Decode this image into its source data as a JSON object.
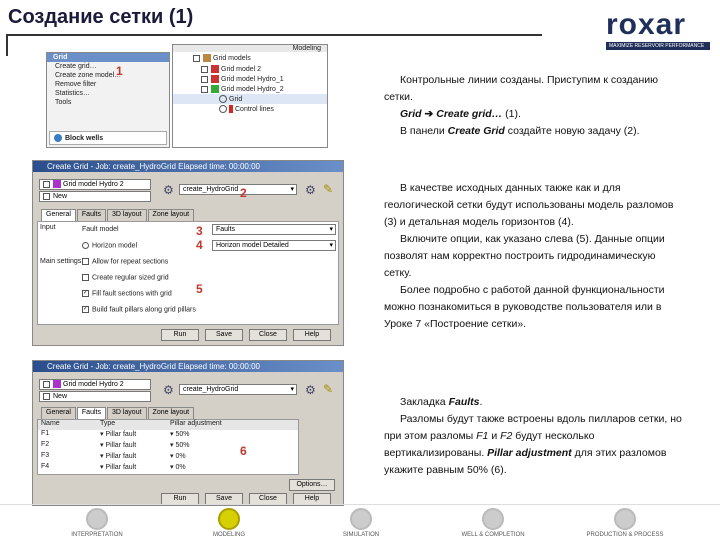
{
  "slide": {
    "title": "Создание сетки (1)",
    "logo_text": "roxar",
    "logo_sub": "MAXIMIZE RESERVOIR PERFORMANCE"
  },
  "text_blocks": {
    "p1a": "Контрольные линии созданы. Приступим к созданию сетки.",
    "p1b_menu": "Grid",
    "p1b_arrow": "➔",
    "p1b_item": "Create grid…",
    "p1b_num": "(1).",
    "p1c_pre": "В панели ",
    "p1c_em": "Create Grid",
    "p1c_post": " создайте новую задачу (2).",
    "p2a": "В качестве исходных данных также как и для геологической сетки будут использованы модель разломов (3) и детальная модель горизонтов (4).",
    "p2b": "Включите опции, как указано слева (5). Данные опции позволят нам корректно построить гидродинамическую сетку.",
    "p2c": "Более подробно с работой данной функциональности можно познакомиться в руководстве пользователя или в Уроке 7 «Построение сетки».",
    "p3a_pre": "Закладка ",
    "p3a_em": "Faults",
    "p3a_post": ".",
    "p3b_pre": "Разломы будут также встроены вдоль пилларов сетки, но при этом разломы ",
    "p3b_f1": "F1",
    "p3b_mid": " и ",
    "p3b_f2": "F2",
    "p3b_post1": " будут несколько вертикализированы. ",
    "p3b_em": "Pillar adjustment",
    "p3b_post2": " для этих разломов укажите равным 50% (6)."
  },
  "markers": {
    "m1": "1",
    "m2": "2",
    "m3": "3",
    "m4": "4",
    "m5": "5",
    "m6": "6"
  },
  "menu_panel": {
    "header": "Grid",
    "items": [
      "Create grid…",
      "Create zone model…",
      "Remove filter",
      "Statistics…",
      "Tools"
    ],
    "footer": "Block wells",
    "right_header": "Modeling",
    "tree": [
      "Grid models",
      "Grid model 2",
      "Grid model Hydro_1",
      "Grid model Hydro_2",
      "Grid",
      "Control lines"
    ]
  },
  "dialog1": {
    "title": "Create Grid - Job: create_HydroGrid  Elapsed time: 00:00:00",
    "model": "Grid model Hydro 2",
    "new_label": "New",
    "job": "create_HydroGrid",
    "tabs": [
      "General",
      "Faults",
      "3D layout",
      "Zone layout"
    ],
    "input_label": "Input",
    "fault_model_label": "Fault model",
    "fault_model_value": "Faults",
    "horizon_model_label": "Horizon model",
    "horizon_model_value": "Horizon model Detailed",
    "main_settings_label": "Main settings",
    "options": [
      "Allow for repeat sections",
      "Create regular sized grid",
      "Fill fault sections with grid",
      "Build fault pillars along grid pillars"
    ],
    "options_checked": [
      false,
      false,
      true,
      true
    ],
    "buttons": [
      "Run",
      "Save",
      "Close",
      "Help"
    ]
  },
  "dialog2": {
    "title": "Create Grid - Job: create_HydroGrid  Elapsed time: 00:00:00",
    "model": "Grid model Hydro 2",
    "new_label": "New",
    "job": "create_HydroGrid",
    "tabs": [
      "General",
      "Faults",
      "3D layout",
      "Zone layout"
    ],
    "col_headers": [
      "Name",
      "Type",
      "Pillar adjustment"
    ],
    "rows": [
      {
        "name": "F1",
        "type": "Pillar fault",
        "adj": "50%"
      },
      {
        "name": "F2",
        "type": "Pillar fault",
        "adj": "50%"
      },
      {
        "name": "F3",
        "type": "Pillar fault",
        "adj": "0%"
      },
      {
        "name": "F4",
        "type": "Pillar fault",
        "adj": "0%"
      }
    ],
    "side_button": "Options…",
    "buttons": [
      "Run",
      "Save",
      "Close",
      "Help"
    ]
  },
  "bottom_nav": [
    "INTERPRETATION",
    "MODELING",
    "SIMULATION",
    "WELL & COMPLETION",
    "PRODUCTION & PROCESS"
  ],
  "colors": {
    "title": "#1a1a3a",
    "marker": "#c0392b",
    "accent": "#d7d000"
  }
}
